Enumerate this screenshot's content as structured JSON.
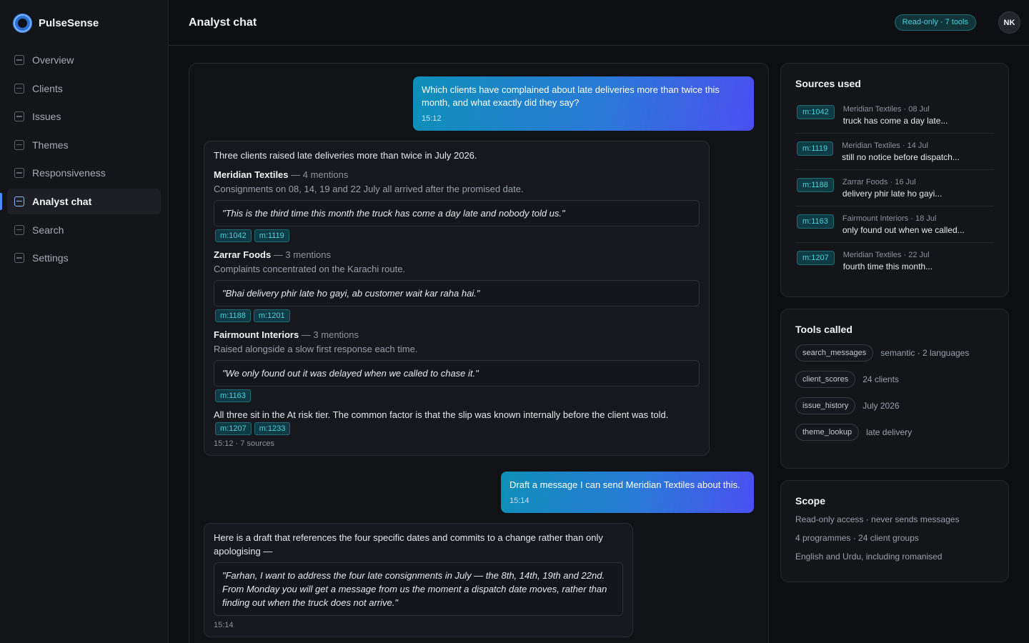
{
  "app": {
    "name": "PulseSense"
  },
  "sidebar": {
    "items": [
      {
        "label": "Overview"
      },
      {
        "label": "Clients"
      },
      {
        "label": "Issues"
      },
      {
        "label": "Themes"
      },
      {
        "label": "Responsiveness"
      },
      {
        "label": "Analyst chat"
      },
      {
        "label": "Search"
      },
      {
        "label": "Settings"
      }
    ],
    "active": "Analyst chat"
  },
  "header": {
    "title": "Analyst chat",
    "badge": "Read-only · 7 tools",
    "avatar": "NK"
  },
  "chat": {
    "user1": {
      "text": "Which clients have complained about late deliveries more than twice this month, and what exactly did they say?",
      "time": "15:12"
    },
    "bot1": {
      "intro": "Three clients raised late deliveries more than twice in July 2026.",
      "clients": [
        {
          "name": "Meridian Textiles",
          "count": "— 4 mentions",
          "desc": "Consignments on 08, 14, 19 and 22 July all arrived after the promised date.",
          "quote": "\"This is the third time this month the truck has come a day late and nobody told us.\"",
          "tags": [
            "m:1042",
            "m:1119"
          ]
        },
        {
          "name": "Zarrar Foods",
          "count": "— 3 mentions",
          "desc": "Complaints concentrated on the Karachi route.",
          "quote": "\"Bhai delivery phir late ho gayi, ab customer wait kar raha hai.\"",
          "tags": [
            "m:1188",
            "m:1201"
          ]
        },
        {
          "name": "Fairmount Interiors",
          "count": "— 3 mentions",
          "desc": "Raised alongside a slow first response each time.",
          "quote": "\"We only found out it was delayed when we called to chase it.\"",
          "tags": [
            "m:1163"
          ]
        }
      ],
      "summary": "All three sit in the At risk tier. The common factor is that the slip was known internally before the client was told.",
      "summary_tags": [
        "m:1207",
        "m:1233"
      ],
      "meta": "15:12 · 7 sources"
    },
    "user2": {
      "text": "Draft a message I can send Meridian Textiles about this.",
      "time": "15:14"
    },
    "bot2": {
      "intro": "Here is a draft that references the four specific dates and commits to a change rather than only apologising —",
      "quote": "\"Farhan, I want to address the four late consignments in July — the 8th, 14th, 19th and 22nd. From Monday you will get a message from us the moment a dispatch date moves, rather than finding out when the truck does not arrive.\"",
      "meta": "15:14"
    }
  },
  "sources": {
    "title": "Sources used",
    "items": [
      {
        "tag": "m:1042",
        "meta": "Meridian Textiles · 08 Jul",
        "text": "truck has come a day late..."
      },
      {
        "tag": "m:1119",
        "meta": "Meridian Textiles · 14 Jul",
        "text": "still no notice before dispatch..."
      },
      {
        "tag": "m:1188",
        "meta": "Zarrar Foods · 16 Jul",
        "text": "delivery phir late ho gayi..."
      },
      {
        "tag": "m:1163",
        "meta": "Fairmount Interiors · 18 Jul",
        "text": "only found out when we called..."
      },
      {
        "tag": "m:1207",
        "meta": "Meridian Textiles · 22 Jul",
        "text": "fourth time this month..."
      }
    ]
  },
  "tools": {
    "title": "Tools called",
    "items": [
      {
        "name": "search_messages",
        "desc": "semantic · 2 languages"
      },
      {
        "name": "client_scores",
        "desc": "24 clients"
      },
      {
        "name": "issue_history",
        "desc": "July 2026"
      },
      {
        "name": "theme_lookup",
        "desc": "late delivery"
      }
    ]
  },
  "scope": {
    "title": "Scope",
    "lines": [
      "Read-only access · never sends messages",
      "4 programmes · 24 client groups",
      "English and Urdu, including romanised"
    ]
  }
}
